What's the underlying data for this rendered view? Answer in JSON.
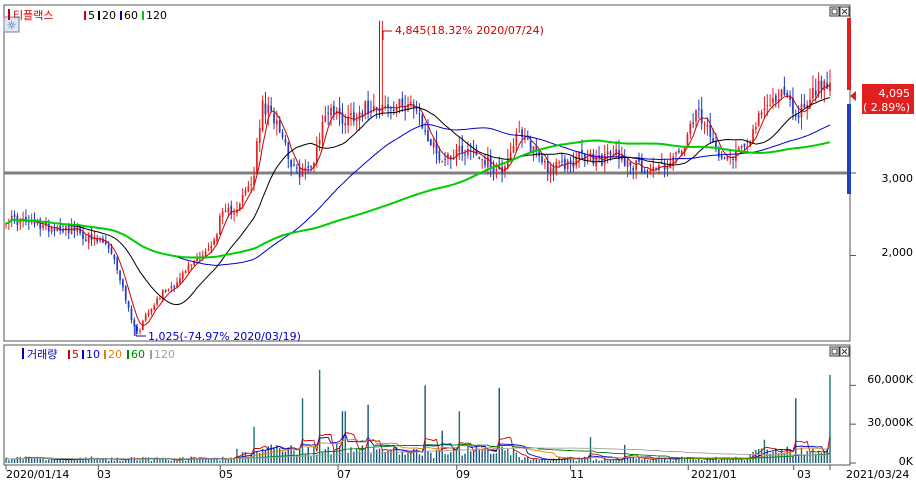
{
  "price_panel": {
    "legend": {
      "stock_name": "티플랙스",
      "ma": [
        {
          "label": "5",
          "color": "#cc0000"
        },
        {
          "label": "20",
          "color": "#000000"
        },
        {
          "label": "60",
          "color": "#0000cc"
        },
        {
          "label": "120",
          "color": "#00cc00"
        }
      ]
    },
    "high_annotation": "4,845(18.32% 2020/07/24)",
    "low_annotation": "1,025(-74.97% 2020/03/19)",
    "current_price": "4,095",
    "current_change": "( 2.89%)",
    "reference_line_value": 3000
  },
  "volume_panel": {
    "legend": {
      "title": "거래량",
      "ma": [
        {
          "label": "5",
          "color": "#cc0000"
        },
        {
          "label": "10",
          "color": "#0000cc"
        },
        {
          "label": "20",
          "color": "#e08000"
        },
        {
          "label": "60",
          "color": "#008000"
        },
        {
          "label": "120",
          "color": "#a0a0a0"
        }
      ]
    }
  },
  "x_axis": {
    "start_label": "2020/01/14",
    "end_label": "2021/03/24",
    "month_labels": [
      "03",
      "05",
      "07",
      "09",
      "11",
      "2021/01",
      "03"
    ]
  },
  "chart_data": [
    {
      "type": "candlestick",
      "title": "티플랙스",
      "y_ticks": [
        "2,000",
        "3,000"
      ],
      "ylim": [
        1000,
        5000
      ],
      "grid": false,
      "series": [
        {
          "name": "price",
          "x_start": "2020/01/14",
          "x_end": "2021/03/24",
          "close_path_points": [
            [
              0,
              2450
            ],
            [
              0.05,
              2350
            ],
            [
              0.08,
              2330
            ],
            [
              0.1,
              2200
            ],
            [
              0.12,
              2150
            ],
            [
              0.135,
              1850
            ],
            [
              0.15,
              1300
            ],
            [
              0.16,
              1050
            ],
            [
              0.17,
              1300
            ],
            [
              0.19,
              1550
            ],
            [
              0.21,
              1700
            ],
            [
              0.22,
              1850
            ],
            [
              0.235,
              2000
            ],
            [
              0.25,
              2100
            ],
            [
              0.26,
              2450
            ],
            [
              0.28,
              2600
            ],
            [
              0.3,
              2900
            ],
            [
              0.31,
              3800
            ],
            [
              0.33,
              3650
            ],
            [
              0.35,
              3000
            ],
            [
              0.37,
              3050
            ],
            [
              0.39,
              3800
            ],
            [
              0.41,
              3650
            ],
            [
              0.43,
              3750
            ],
            [
              0.45,
              3850
            ],
            [
              0.47,
              3750
            ],
            [
              0.49,
              3900
            ],
            [
              0.51,
              3450
            ],
            [
              0.53,
              3150
            ],
            [
              0.55,
              3300
            ],
            [
              0.57,
              3250
            ],
            [
              0.6,
              3000
            ],
            [
              0.62,
              3450
            ],
            [
              0.64,
              3300
            ],
            [
              0.66,
              3050
            ],
            [
              0.68,
              3100
            ],
            [
              0.7,
              3200
            ],
            [
              0.72,
              3150
            ],
            [
              0.74,
              3250
            ],
            [
              0.76,
              3100
            ],
            [
              0.78,
              3050
            ],
            [
              0.8,
              3100
            ],
            [
              0.82,
              3250
            ],
            [
              0.84,
              3750
            ],
            [
              0.86,
              3300
            ],
            [
              0.88,
              3200
            ],
            [
              0.9,
              3400
            ],
            [
              0.92,
              3750
            ],
            [
              0.94,
              4000
            ],
            [
              0.96,
              3700
            ],
            [
              0.98,
              4000
            ],
            [
              1.0,
              4095
            ]
          ],
          "high": 4845,
          "low": 1025,
          "last": 4095
        },
        {
          "name": "MA5",
          "color": "#cc0000"
        },
        {
          "name": "MA20",
          "color": "#000000"
        },
        {
          "name": "MA60",
          "color": "#0000cc"
        },
        {
          "name": "MA120",
          "color": "#00cc00"
        }
      ]
    },
    {
      "type": "bar",
      "title": "거래량",
      "y_ticks": [
        "0K",
        "30,000K",
        "60,000K"
      ],
      "ylim": [
        0,
        78000
      ],
      "spikes": [
        [
          0.3,
          28000
        ],
        [
          0.36,
          50000
        ],
        [
          0.38,
          72000
        ],
        [
          0.41,
          40000
        ],
        [
          0.44,
          45000
        ],
        [
          0.51,
          60000
        ],
        [
          0.53,
          25000
        ],
        [
          0.55,
          40000
        ],
        [
          0.6,
          58000
        ],
        [
          0.71,
          20000
        ],
        [
          0.75,
          14000
        ],
        [
          0.92,
          18000
        ],
        [
          0.96,
          50000
        ],
        [
          1.0,
          68000
        ]
      ]
    }
  ]
}
